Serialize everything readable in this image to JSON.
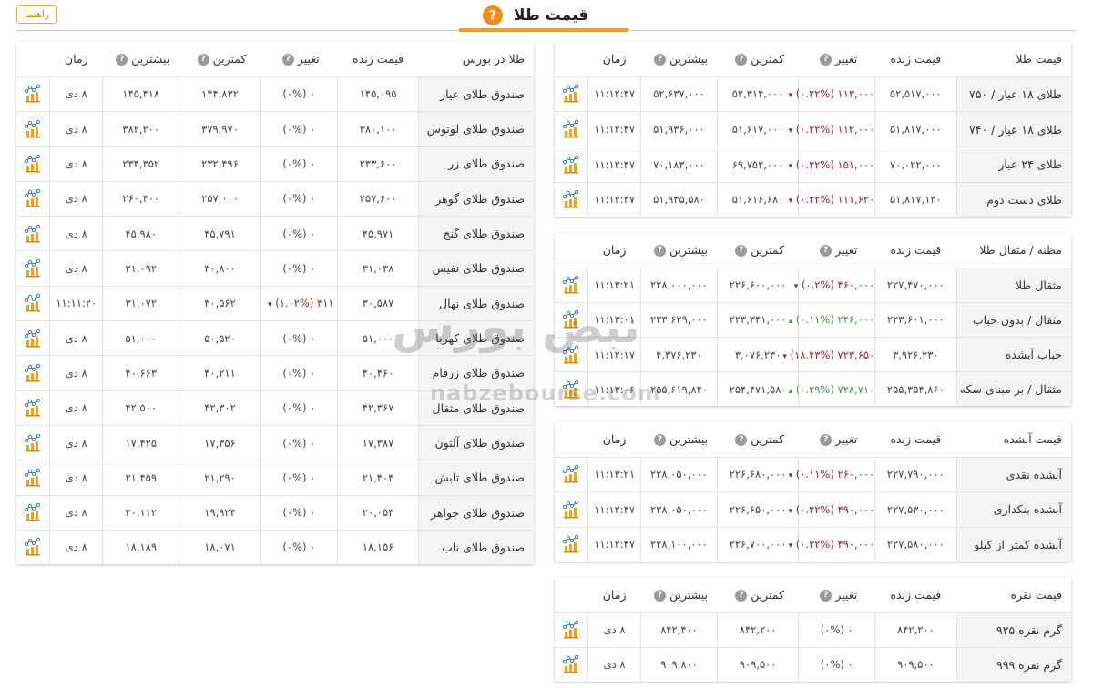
{
  "header": {
    "title": "قیمت طلا",
    "help_icon": "question-icon",
    "guide_button": "راهنما"
  },
  "colors": {
    "accent": "#f2a01e",
    "down": "#a3202e",
    "up": "#3a9a3a"
  },
  "watermark": {
    "fa": "نبض بورس",
    "en": "nabzebourse.com"
  },
  "common_headers": {
    "live": "قیمت زنده",
    "change": "تغییر",
    "low": "کمترین",
    "high": "بیشترین",
    "time": "زمان"
  },
  "gold_price": {
    "title": "قیمت طلا",
    "rows": [
      {
        "name": "طلای ۱۸ عیار / ۷۵۰",
        "live": "۵۲,۵۱۷,۰۰۰",
        "change": "۱۱۳,۰۰۰ (۰.۲۲%)",
        "dir": "down",
        "low": "۵۲,۳۱۴,۰۰۰",
        "high": "۵۲,۶۳۷,۰۰۰",
        "time": "۱۱:۱۲:۴۷"
      },
      {
        "name": "طلای ۱۸ عیار / ۷۴۰",
        "live": "۵۱,۸۱۷,۰۰۰",
        "change": "۱۱۲,۰۰۰ (۰.۲۲%)",
        "dir": "down",
        "low": "۵۱,۶۱۷,۰۰۰",
        "high": "۵۱,۹۳۶,۰۰۰",
        "time": "۱۱:۱۲:۴۷"
      },
      {
        "name": "طلای ۲۴ عیار",
        "live": "۷۰,۰۲۲,۰۰۰",
        "change": "۱۵۱,۰۰۰ (۰.۲۲%)",
        "dir": "down",
        "low": "۶۹,۷۵۲,۰۰۰",
        "high": "۷۰,۱۸۳,۰۰۰",
        "time": "۱۱:۱۲:۴۷"
      },
      {
        "name": "طلای دست دوم",
        "live": "۵۱,۸۱۷,۱۳۰",
        "change": "۱۱۱,۶۲۰ (۰.۲۲%)",
        "dir": "down",
        "low": "۵۱,۶۱۶,۶۸۰",
        "high": "۵۱,۹۳۵,۵۸۰",
        "time": "۱۱:۱۲:۴۷"
      }
    ]
  },
  "mesghal": {
    "title": "مظنه / مثقال طلا",
    "rows": [
      {
        "name": "مثقال طلا",
        "live": "۲۲۷,۴۷۰,۰۰۰",
        "change": "۴۶۰,۰۰۰ (۰.۲%)",
        "dir": "down",
        "low": "۲۲۶,۶۰۰,۰۰۰",
        "high": "۲۲۸,۰۰۰,۰۰۰",
        "time": "۱۱:۱۳:۲۱"
      },
      {
        "name": "مثقال / بدون حباب",
        "live": "۲۲۳,۶۰۱,۰۰۰",
        "change": "۲۴۶,۰۰۰ (۰.۱۱%)",
        "dir": "up",
        "low": "۲۲۳,۳۴۱,۰۰۰",
        "high": "۲۲۳,۶۲۹,۰۰۰",
        "time": "۱۱:۱۳:۰۱"
      },
      {
        "name": "حباب آبشده",
        "live": "۳,۹۲۶,۲۳۰",
        "change": "۷۲۳,۶۵۰ (۱۸.۴۳%)",
        "dir": "down",
        "low": "۳,۰۷۶,۲۳۰",
        "high": "۴,۳۷۶,۲۳۰",
        "time": "۱۱:۱۲:۱۷"
      },
      {
        "name": "مثقال / بر مبنای سکه",
        "live": "۲۵۵,۳۵۴,۸۶۰",
        "change": "۷۲۸,۷۱۰ (۰.۲۹%)",
        "dir": "up",
        "low": "۲۵۴,۴۷۱,۵۸۰",
        "high": "۲۵۵,۶۱۹,۸۴۰",
        "time": "۱۱:۱۳:۰۶"
      }
    ]
  },
  "abshodeh": {
    "title": "قیمت آبشده",
    "rows": [
      {
        "name": "آبشده نقدی",
        "live": "۲۲۷,۷۹۰,۰۰۰",
        "change": "۲۶۰,۰۰۰ (۰.۱۱%)",
        "dir": "down",
        "low": "۲۲۶,۶۸۰,۰۰۰",
        "high": "۲۲۸,۰۵۰,۰۰۰",
        "time": "۱۱:۱۳:۲۱"
      },
      {
        "name": "آبشده بنکداری",
        "live": "۲۲۷,۵۳۰,۰۰۰",
        "change": "۴۹۰,۰۰۰ (۰.۲۲%)",
        "dir": "down",
        "low": "۲۲۶,۶۵۰,۰۰۰",
        "high": "۲۲۸,۰۵۰,۰۰۰",
        "time": "۱۱:۱۲:۴۷"
      },
      {
        "name": "آبشده کمتر از کیلو",
        "live": "۲۲۷,۵۸۰,۰۰۰",
        "change": "۴۹۰,۰۰۰ (۰.۲۲%)",
        "dir": "down",
        "low": "۲۲۶,۷۰۰,۰۰۰",
        "high": "۲۲۸,۱۰۰,۰۰۰",
        "time": "۱۱:۱۲:۴۷"
      }
    ]
  },
  "silver": {
    "title": "قیمت نقره",
    "rows": [
      {
        "name": "گرم نقره ۹۲۵",
        "live": "۸۴۲,۲۰۰",
        "change": "۰ (۰%)",
        "dir": "none",
        "low": "۸۴۲,۲۰۰",
        "high": "۸۴۲,۴۰۰",
        "time": "۸ دی"
      },
      {
        "name": "گرم نقره ۹۹۹",
        "live": "۹۰۹,۵۰۰",
        "change": "۰ (۰%)",
        "dir": "none",
        "low": "۹۰۹,۵۰۰",
        "high": "۹۰۹,۸۰۰",
        "time": "۸ دی"
      }
    ]
  },
  "bourse": {
    "title": "طلا در بورس",
    "rows": [
      {
        "name": "صندوق طلای عیار",
        "live": "۱۴۵,۰۹۵",
        "change": "۰ (۰%)",
        "dir": "none",
        "low": "۱۴۴,۸۳۲",
        "high": "۱۴۵,۴۱۸",
        "time": "۸ دی"
      },
      {
        "name": "صندوق طلای لوتوس",
        "live": "۳۸۰,۱۰۰",
        "change": "۰ (۰%)",
        "dir": "none",
        "low": "۳۷۹,۹۷۰",
        "high": "۳۸۲,۲۰۰",
        "time": "۸ دی"
      },
      {
        "name": "صندوق طلای زر",
        "live": "۲۳۳,۶۰۰",
        "change": "۰ (۰%)",
        "dir": "none",
        "low": "۲۳۲,۴۹۶",
        "high": "۲۳۴,۳۵۲",
        "time": "۸ دی"
      },
      {
        "name": "صندوق طلای گوهر",
        "live": "۲۵۷,۶۰۰",
        "change": "۰ (۰%)",
        "dir": "none",
        "low": "۲۵۷,۰۰۰",
        "high": "۲۶۰,۴۰۰",
        "time": "۸ دی"
      },
      {
        "name": "صندوق طلای گنج",
        "live": "۴۵,۹۷۱",
        "change": "۰ (۰%)",
        "dir": "none",
        "low": "۴۵,۷۹۱",
        "high": "۴۵,۹۸۰",
        "time": "۸ دی"
      },
      {
        "name": "صندوق طلای نفیس",
        "live": "۳۱,۰۳۸",
        "change": "۰ (۰%)",
        "dir": "none",
        "low": "۳۰,۸۰۰",
        "high": "۳۱,۰۹۲",
        "time": "۸ دی"
      },
      {
        "name": "صندوق طلای نهال",
        "live": "۳۰,۵۸۷",
        "change": "۳۱۱ (۱.۰۲%)",
        "dir": "down",
        "low": "۳۰,۵۶۲",
        "high": "۳۱,۰۷۲",
        "time": "۱۱:۱۱:۲۰"
      },
      {
        "name": "صندوق طلای کهربا",
        "live": "۵۱,۰۰۰",
        "change": "۰ (۰%)",
        "dir": "none",
        "low": "۵۰,۵۲۰",
        "high": "۵۱,۰۰۰",
        "time": "۸ دی"
      },
      {
        "name": "صندوق طلای زرفام",
        "live": "۴۰,۴۶۰",
        "change": "۰ (۰%)",
        "dir": "none",
        "low": "۴۰,۲۱۱",
        "high": "۴۰,۶۶۳",
        "time": "۸ دی"
      },
      {
        "name": "صندوق طلای مثقال",
        "live": "۴۲,۳۶۷",
        "change": "۰ (۰%)",
        "dir": "none",
        "low": "۴۲,۳۰۲",
        "high": "۴۲,۵۰۰",
        "time": "۸ دی"
      },
      {
        "name": "صندوق طلای آلتون",
        "live": "۱۷,۳۸۷",
        "change": "۰ (۰%)",
        "dir": "none",
        "low": "۱۷,۳۵۶",
        "high": "۱۷,۴۲۵",
        "time": "۸ دی"
      },
      {
        "name": "صندوق طلای تابش",
        "live": "۲۱,۴۰۴",
        "change": "۰ (۰%)",
        "dir": "none",
        "low": "۲۱,۲۹۰",
        "high": "۲۱,۴۵۹",
        "time": "۸ دی"
      },
      {
        "name": "صندوق طلای جواهر",
        "live": "۲۰,۰۵۴",
        "change": "۰ (۰%)",
        "dir": "none",
        "low": "۱۹,۹۲۴",
        "high": "۲۰,۱۱۲",
        "time": "۸ دی"
      },
      {
        "name": "صندوق طلای ناب",
        "live": "۱۸,۱۵۶",
        "change": "۰ (۰%)",
        "dir": "none",
        "low": "۱۸,۰۷۱",
        "high": "۱۸,۱۸۹",
        "time": "۸ دی"
      }
    ]
  }
}
